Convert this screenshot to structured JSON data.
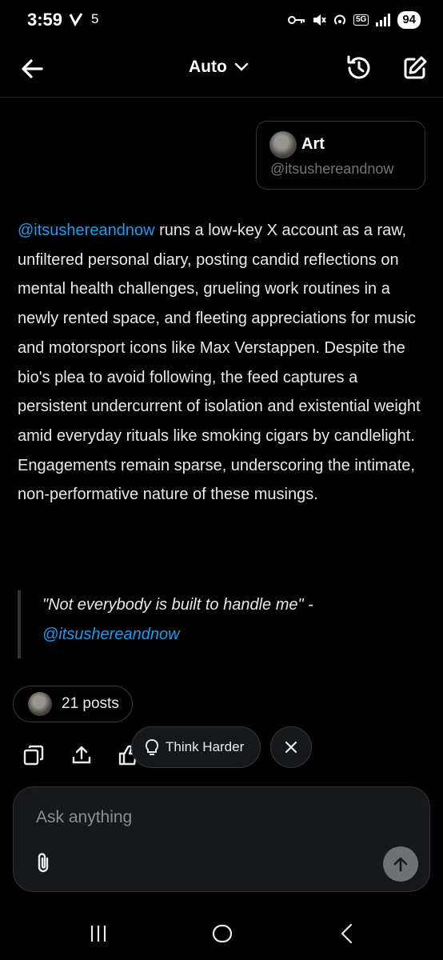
{
  "status_bar": {
    "time": "3:59",
    "notification_count": "5",
    "network_badge": "5G",
    "battery": "94"
  },
  "header": {
    "mode_label": "Auto",
    "icons": [
      "back-arrow-icon",
      "chevron-down-icon",
      "history-icon",
      "new-chat-edit-icon"
    ]
  },
  "user_card": {
    "name": "Art",
    "handle": "@itsushereandnow"
  },
  "summary": {
    "mention": "@itsushereandnow",
    "text": " runs a low-key X account as a raw, unfiltered personal diary, posting candid reflections on mental health challenges, grueling work routines in a newly rented space, and fleeting appreciations for music and motorsport icons like Max Verstappen. Despite the bio's plea to avoid following, the feed captures a persistent undercurrent of isolation and existential weight amid everyday rituals like smoking cigars by candlelight. Engagements remain sparse, underscoring the intimate, non-performative nature of these musings."
  },
  "quote": {
    "text": "\"Not everybody is built to handle me\" -",
    "mention": "@itsushereandnow"
  },
  "posts_chip": {
    "label": "21 posts"
  },
  "actions": {
    "icons": [
      "copy-icon",
      "share-icon",
      "thumbs-up-icon"
    ],
    "think_label": "Think Harder"
  },
  "composer": {
    "placeholder": "Ask anything"
  },
  "colors": {
    "background": "#000000",
    "accent": "#1d9bf0",
    "text": "#e7e9ea",
    "muted": "#71767b"
  }
}
